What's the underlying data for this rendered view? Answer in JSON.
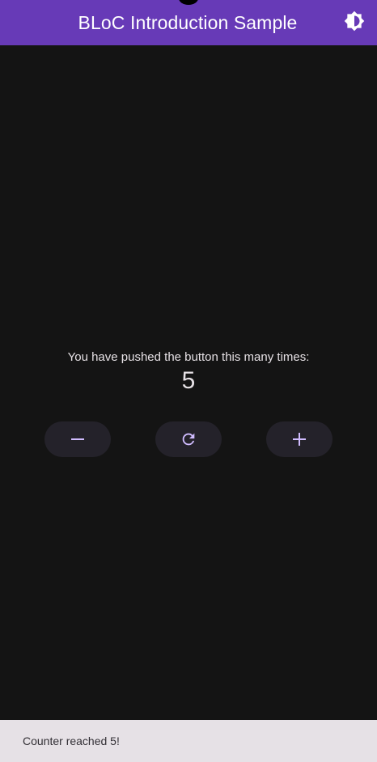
{
  "appbar": {
    "title": "BLoC Introduction Sample",
    "theme_toggle_icon": "brightness-icon",
    "background_color": "#673ab7"
  },
  "counter": {
    "message": "You have pushed the button this many times:",
    "value": "5"
  },
  "buttons": {
    "decrement_icon": "minus-icon",
    "reset_icon": "refresh-icon",
    "increment_icon": "plus-icon",
    "accent_color": "#d0bcff"
  },
  "snackbar": {
    "text": "Counter reached 5!"
  }
}
